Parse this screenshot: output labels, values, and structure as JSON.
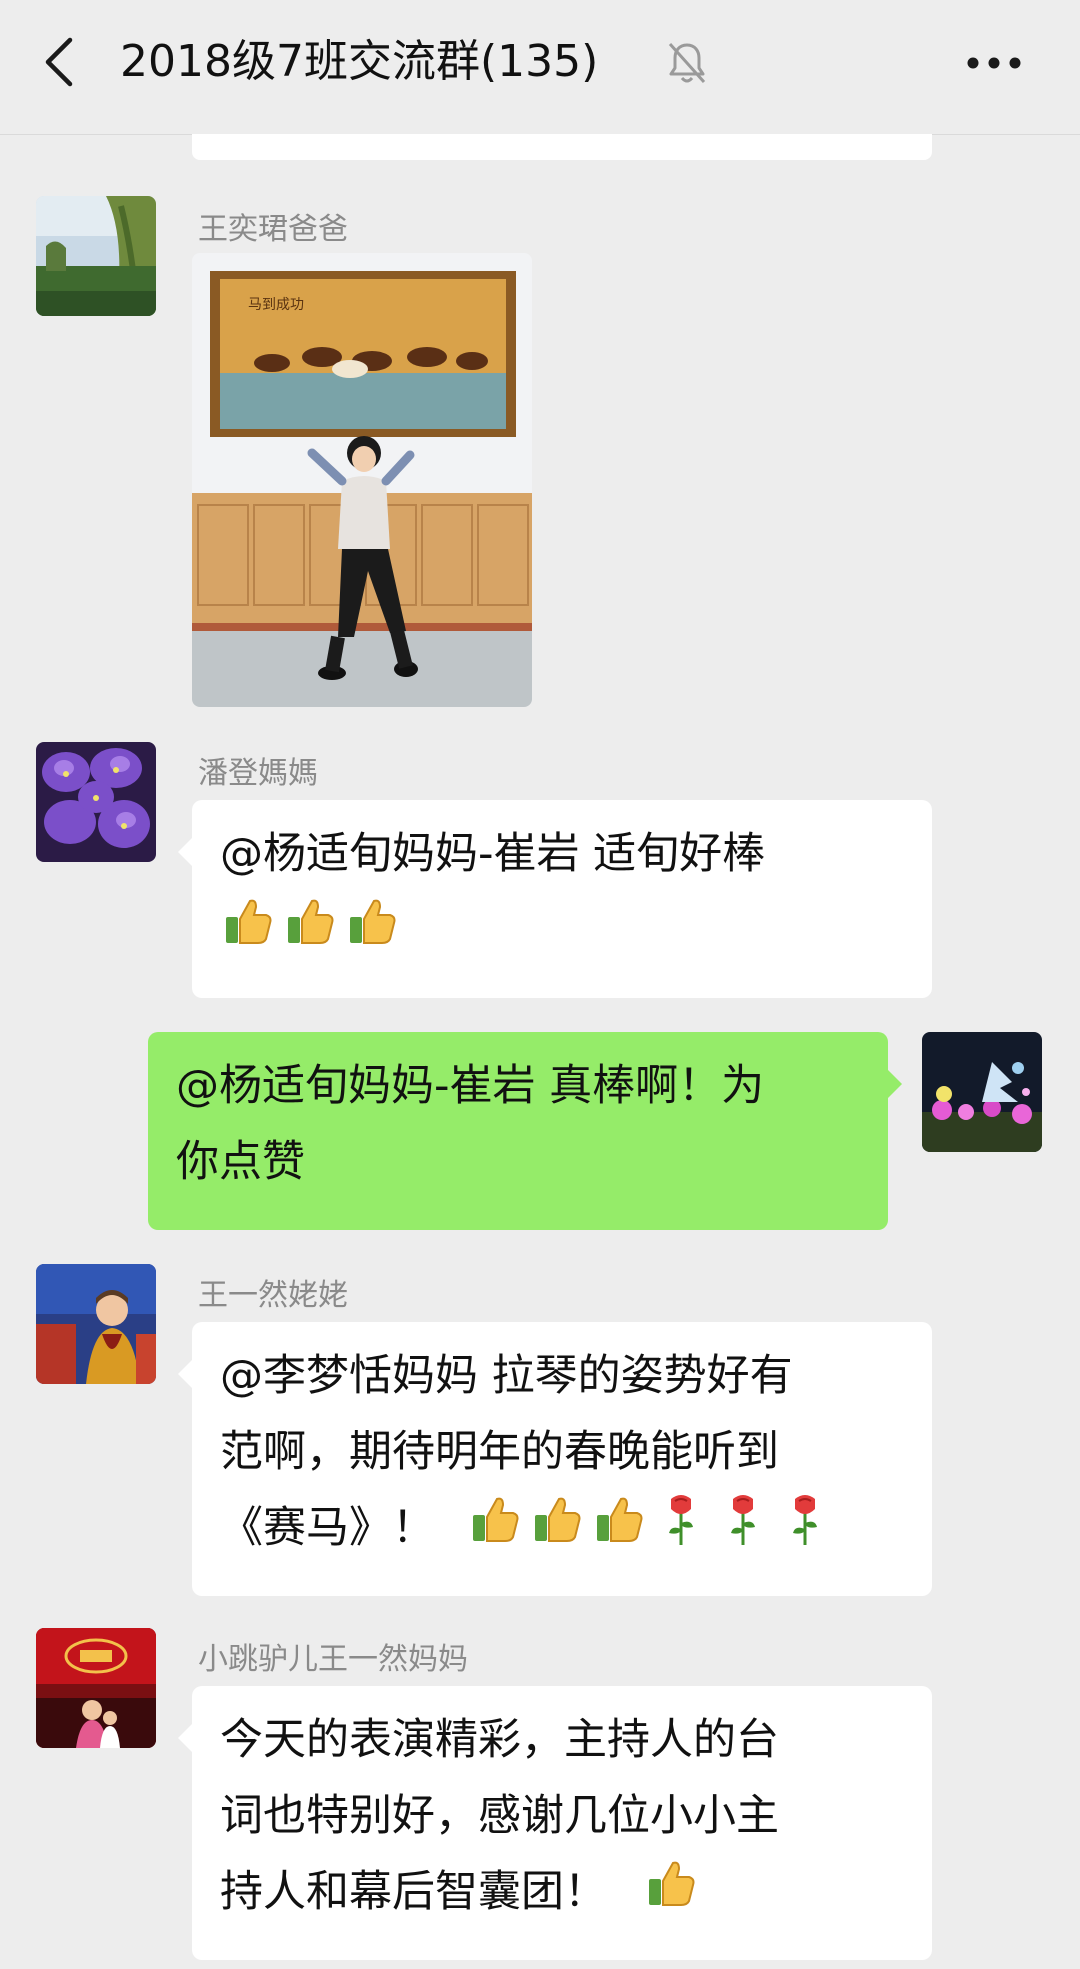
{
  "header": {
    "title": "2018级7班交流群(135)",
    "back_icon": "chevron-left-icon",
    "mute_icon": "bell-off-icon",
    "more_icon": "ellipsis-icon"
  },
  "messages": [
    {
      "sender": "王奕珺爸爸",
      "type": "image",
      "image_text": "马到成功"
    },
    {
      "sender": "潘登媽媽",
      "lines": [
        "@杨适旬妈妈-崔岩  适旬好棒"
      ],
      "emojis": [
        "thumbs-up",
        "thumbs-up",
        "thumbs-up"
      ]
    },
    {
      "sender": "",
      "self": true,
      "lines": [
        "@杨适旬妈妈-崔岩  真棒啊！为",
        "你点赞"
      ]
    },
    {
      "sender": "王一然姥姥",
      "lines": [
        "@李梦恬妈妈  拉琴的姿势好有",
        "范啊，期待明年的春晚能听到",
        "《赛马》！"
      ],
      "emojis": [
        "thumbs-up",
        "thumbs-up",
        "thumbs-up",
        "rose",
        "rose",
        "rose"
      ]
    },
    {
      "sender": "小跳驴儿王一然妈妈",
      "lines": [
        "今天的表演精彩，主持人的台",
        "词也特别好，感谢几位小小主",
        "持人和幕后智囊团！"
      ],
      "emojis": [
        "thumbs-up"
      ]
    }
  ],
  "colors": {
    "background": "#ededed",
    "self_bubble": "#95ec69",
    "other_bubble": "#ffffff",
    "sender_name": "#8a8a8a"
  }
}
